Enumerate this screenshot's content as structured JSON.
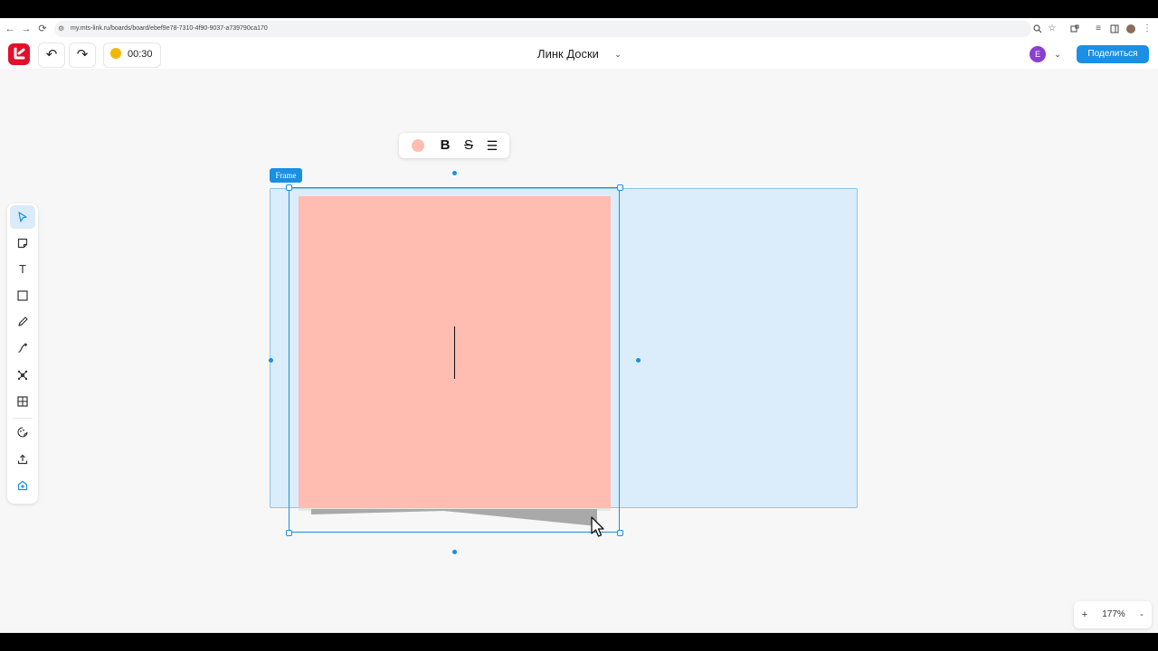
{
  "browser": {
    "url": "my.mts-link.ru/boards/board/ebef9e78-7310-4f90-9037-a739790ca170",
    "back": "←",
    "forward": "→",
    "reload": "⟳"
  },
  "header": {
    "logo": "L",
    "undo": "↶",
    "redo": "↷",
    "timer": "00:30",
    "title": "Линк Доски",
    "title_chevron": "⌄",
    "avatar_letter": "E",
    "avatar_chevron": "⌄",
    "share_label": "Поделиться"
  },
  "toolbar": {
    "tools": [
      {
        "name": "select",
        "icon": "cursor-icon"
      },
      {
        "name": "sticky-note",
        "icon": "sticky-note-icon"
      },
      {
        "name": "text",
        "icon": "text-icon"
      },
      {
        "name": "shape",
        "icon": "square-icon"
      },
      {
        "name": "pen",
        "icon": "pencil-icon"
      },
      {
        "name": "connector",
        "icon": "connector-icon"
      },
      {
        "name": "mindmap",
        "icon": "mindmap-icon"
      },
      {
        "name": "table",
        "icon": "table-icon"
      },
      {
        "name": "stickers",
        "icon": "palette-icon"
      },
      {
        "name": "upload",
        "icon": "upload-icon"
      },
      {
        "name": "apps",
        "icon": "plus-box-icon"
      }
    ],
    "text_glyph": "T"
  },
  "frame": {
    "label": "Frame"
  },
  "format_toolbar": {
    "bold": "B",
    "strike": "S",
    "list": "☰",
    "note_color": "#ffbcb0"
  },
  "zoom": {
    "plus": "+",
    "level": "177%",
    "minus": "-"
  },
  "colors": {
    "accent": "#1a8fe3",
    "sticky": "#ffbcb0",
    "frame": "#dbedfa",
    "logo": "#e3102b"
  }
}
